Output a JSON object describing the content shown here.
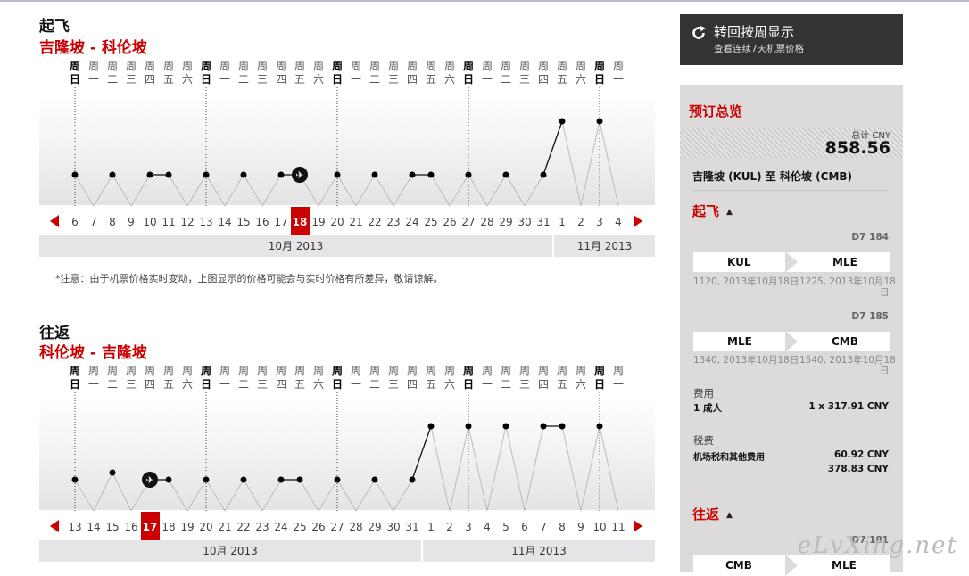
{
  "outbound": {
    "title": "起飞",
    "route": "吉隆坡 - 科伦坡",
    "weekdays": [
      "日",
      "一",
      "二",
      "三",
      "四",
      "五",
      "六",
      "日",
      "一",
      "二",
      "三",
      "四",
      "五",
      "六",
      "日",
      "一",
      "二",
      "三",
      "四",
      "五",
      "六",
      "日",
      "一",
      "二",
      "三",
      "四",
      "五",
      "六",
      "日",
      "一"
    ],
    "dates": [
      "6",
      "7",
      "8",
      "9",
      "10",
      "11",
      "12",
      "13",
      "14",
      "15",
      "16",
      "17",
      "18",
      "19",
      "20",
      "21",
      "22",
      "23",
      "24",
      "25",
      "26",
      "27",
      "28",
      "29",
      "30",
      "31",
      "1",
      "2",
      "3",
      "4"
    ],
    "prices": [
      "low",
      "none",
      "low",
      "none",
      "low",
      "low",
      "none",
      "low",
      "none",
      "low",
      "none",
      "low",
      "low",
      "none",
      "low",
      "none",
      "low",
      "none",
      "low",
      "low",
      "none",
      "low",
      "none",
      "low",
      "none",
      "low",
      "high",
      "none",
      "high",
      "none"
    ],
    "selected_index": 12,
    "months": [
      {
        "label": "10月 2013",
        "days": 26
      },
      {
        "label": "11月 2013",
        "days": 4
      }
    ],
    "note": "*注意：由于机票价格实时变动，上图显示的价格可能会与实时价格有所差异，敬请谅解。"
  },
  "return": {
    "title": "往返",
    "route": "科伦坡 - 吉隆坡",
    "weekdays": [
      "日",
      "一",
      "二",
      "三",
      "四",
      "五",
      "六",
      "日",
      "一",
      "二",
      "三",
      "四",
      "五",
      "六",
      "日",
      "一",
      "二",
      "三",
      "四",
      "五",
      "六",
      "日",
      "一",
      "二",
      "三",
      "四",
      "五",
      "六",
      "日",
      "一"
    ],
    "dates": [
      "13",
      "14",
      "15",
      "16",
      "17",
      "18",
      "19",
      "20",
      "21",
      "22",
      "23",
      "24",
      "25",
      "26",
      "27",
      "28",
      "29",
      "30",
      "31",
      "1",
      "2",
      "3",
      "4",
      "5",
      "6",
      "7",
      "8",
      "9",
      "10",
      "11"
    ],
    "prices": [
      "low",
      "none",
      "mid",
      "none",
      "low",
      "low",
      "none",
      "low",
      "none",
      "low",
      "none",
      "low",
      "low",
      "none",
      "low",
      "none",
      "low",
      "none",
      "low",
      "high",
      "none",
      "high",
      "none",
      "high",
      "none",
      "high",
      "high",
      "none",
      "high",
      "none"
    ],
    "selected_index": 4,
    "months": [
      {
        "label": "10月 2013",
        "days": 19
      },
      {
        "label": "11月 2013",
        "days": 11
      }
    ]
  },
  "week_button": {
    "label": "转回按周显示",
    "sub": "查看连续7天机票价格"
  },
  "summary": {
    "title": "预订总览",
    "total_label": "总计 CNY",
    "total": "858.56",
    "route": "吉隆坡 (KUL) 至 科伦坡 (CMB)",
    "outbound_title": "起飞",
    "flights": [
      {
        "no": "D7 184",
        "from": "KUL",
        "to": "MLE",
        "dep": "1120, 2013年10月18日",
        "arr": "1225, 2013年10月18",
        "arr_cont": "日"
      },
      {
        "no": "D7 185",
        "from": "MLE",
        "to": "CMB",
        "dep": "1340, 2013年10月18日",
        "arr": "1540, 2013年10月18",
        "arr_cont": "日"
      }
    ],
    "fee_label": "费用",
    "pax": "1 成人",
    "fare": "1 x 317.91 CNY",
    "tax_label": "税费",
    "tax_item": "机场税和其他费用",
    "tax_amt": "60.92 CNY",
    "subtotal": "378.83 CNY",
    "return_title": "往返",
    "ret_flight_no": "D7 181",
    "ret_from": "CMB",
    "ret_to": "MLE"
  },
  "watermark": "eLvXing.net",
  "colors": {
    "accent": "#cc0000",
    "panel": "#dcdada",
    "dark_button": "#333333"
  }
}
